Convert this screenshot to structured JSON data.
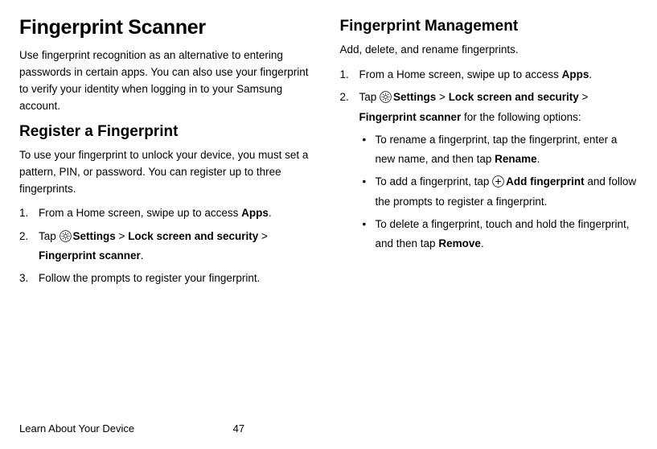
{
  "left": {
    "h1": "Fingerprint Scanner",
    "intro": "Use fingerprint recognition as an alternative to entering passwords in certain apps. You can also use your fingerprint to verify your identity when logging in to your Samsung account.",
    "h2_register": "Register a Fingerprint",
    "register_desc": "To use your fingerprint to unlock your device, you must set a pattern, PIN, or password. You can register up to three fingerprints.",
    "step1_pre": "From a Home screen, swipe up to access ",
    "step1_bold": "Apps",
    "step1_post": ".",
    "step2_pre": "Tap ",
    "step2_settings": "Settings ",
    "step2_gt1": "> ",
    "step2_lock": "Lock screen and security ",
    "step2_gt2": "> ",
    "step2_fps": "Fingerprint scanner",
    "step2_post": ".",
    "step3": "Follow the prompts to register your fingerprint."
  },
  "right": {
    "h2_mgmt": "Fingerprint Management",
    "mgmt_desc": "Add, delete, and rename fingerprints.",
    "r_step1_pre": "From a Home screen, swipe up to access ",
    "r_step1_bold": "Apps",
    "r_step1_post": ".",
    "r_step2_pre": "Tap ",
    "r_step2_settings": "Settings ",
    "r_step2_gt1": "> ",
    "r_step2_lock": "Lock screen and security ",
    "r_step2_gt2": "> ",
    "r_step2_fps": "Fingerprint scanner",
    "r_step2_post": " for the following options:",
    "b1_pre": "To rename a fingerprint, tap the fingerprint, enter a new name, and then tap ",
    "b1_bold": "Rename",
    "b1_post": ".",
    "b2_pre": "To add a fingerprint, tap ",
    "b2_bold": "Add fingerprint",
    "b2_post": " and follow the prompts to register a fingerprint.",
    "b3_pre": "To delete a fingerprint, touch and hold the fingerprint, and then tap ",
    "b3_bold": "Remove",
    "b3_post": "."
  },
  "footer": {
    "left": "Learn About Your Device",
    "page": "47"
  }
}
